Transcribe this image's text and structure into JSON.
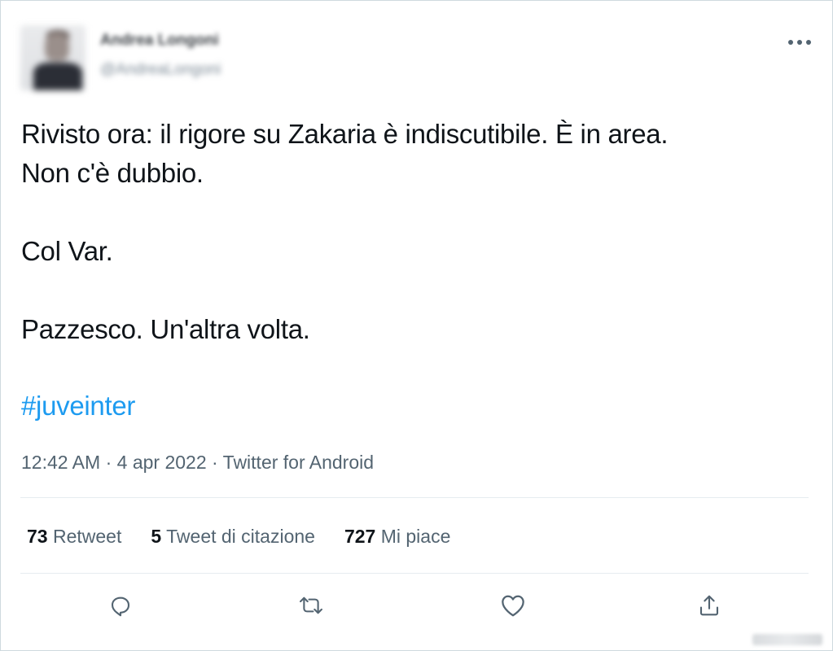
{
  "tweet": {
    "author": {
      "display_name": "Andrea Longoni",
      "handle": "@AndreaLongoni"
    },
    "text_lines": [
      "Rivisto ora: il rigore su Zakaria è indiscutibile. È in area.",
      "Non c'è dubbio.",
      "Col Var.",
      "Pazzesco. Un'altra volta."
    ],
    "hashtag": "#juveinter",
    "time": "12:42 AM",
    "separator": "·",
    "date": "4 apr 2022",
    "source": "Twitter for Android"
  },
  "stats": {
    "retweets": {
      "count": "73",
      "label": "Retweet"
    },
    "quotes": {
      "count": "5",
      "label": "Tweet di citazione"
    },
    "likes": {
      "count": "727",
      "label": "Mi piace"
    }
  },
  "icons": {
    "more": "more-horizontal-icon",
    "reply": "reply-icon",
    "retweet": "retweet-icon",
    "like": "heart-icon",
    "share": "share-icon"
  },
  "colors": {
    "text": "#0f1419",
    "secondary": "#536471",
    "link": "#1d9bf0",
    "border": "#cfd9de"
  }
}
